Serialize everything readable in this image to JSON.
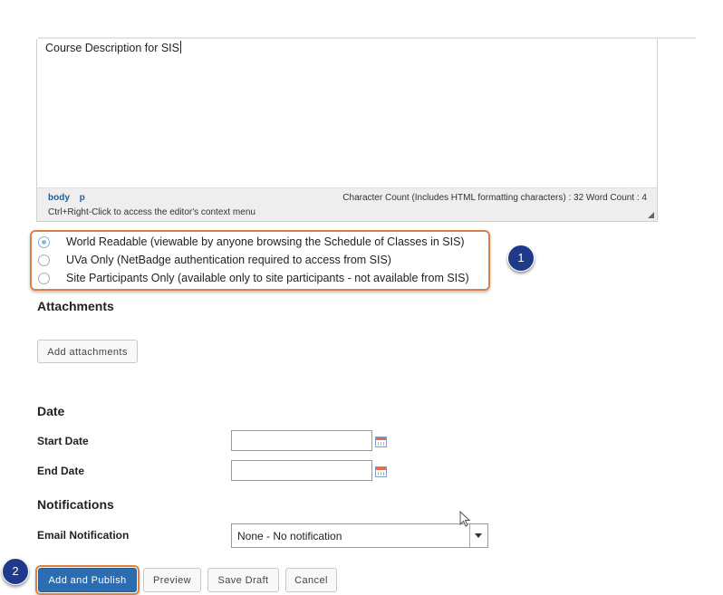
{
  "editor": {
    "content": "Course Description for SIS",
    "path": [
      "body",
      "p"
    ],
    "counts": "Character Count (Includes HTML formatting characters) : 32 Word Count : 4",
    "context_hint": "Ctrl+Right-Click to access the editor's context menu"
  },
  "visibility": {
    "options": [
      {
        "label": "World Readable (viewable by anyone browsing the Schedule of Classes in SIS)",
        "checked": true
      },
      {
        "label": "UVa Only (NetBadge authentication required to access from SIS)",
        "checked": false
      },
      {
        "label": "Site Participants Only (available only to site participants - not available from SIS)",
        "checked": false
      }
    ]
  },
  "badges": {
    "one": "1",
    "two": "2"
  },
  "attachments": {
    "heading": "Attachments",
    "button": "Add attachments"
  },
  "date": {
    "heading": "Date",
    "start_label": "Start Date",
    "end_label": "End Date",
    "start_value": "",
    "end_value": "",
    "calendar_icon": "calendar-icon"
  },
  "notifications": {
    "heading": "Notifications",
    "email_label": "Email Notification",
    "email_value": "None - No notification"
  },
  "actions": {
    "publish": "Add and Publish",
    "preview": "Preview",
    "save_draft": "Save Draft",
    "cancel": "Cancel"
  },
  "colors": {
    "highlight": "#d9824a",
    "badge": "#1f3a8a",
    "primary": "#2c6cb0"
  }
}
